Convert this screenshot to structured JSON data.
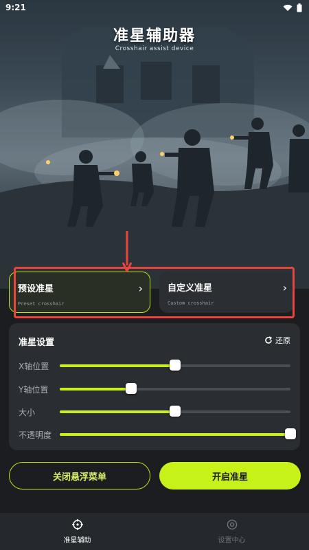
{
  "status_bar": {
    "time": "9:21"
  },
  "hero": {
    "title": "准星辅助器",
    "subtitle": "Crosshair assist device"
  },
  "modes": [
    {
      "title": "预设准星",
      "subtitle": "Preset crosshair",
      "selected": true
    },
    {
      "title": "自定义准星",
      "subtitle": "Custom crosshair",
      "selected": false
    }
  ],
  "settings": {
    "title": "准星设置",
    "reset_label": "还原",
    "sliders": [
      {
        "label": "X轴位置",
        "value": 0.5
      },
      {
        "label": "Y轴位置",
        "value": 0.31
      },
      {
        "label": "大小",
        "value": 0.5
      },
      {
        "label": "不透明度",
        "value": 1.0
      }
    ]
  },
  "buttons": {
    "close_float": "关闭悬浮菜单",
    "start": "开启准星"
  },
  "nav": [
    {
      "label": "准星辅助",
      "icon": "crosshair-icon",
      "active": true
    },
    {
      "label": "设置中心",
      "icon": "settings-icon",
      "active": false
    }
  ],
  "colors": {
    "accent": "#c6f21a",
    "annotation": "#e8453c",
    "background": "#1b1d20"
  }
}
